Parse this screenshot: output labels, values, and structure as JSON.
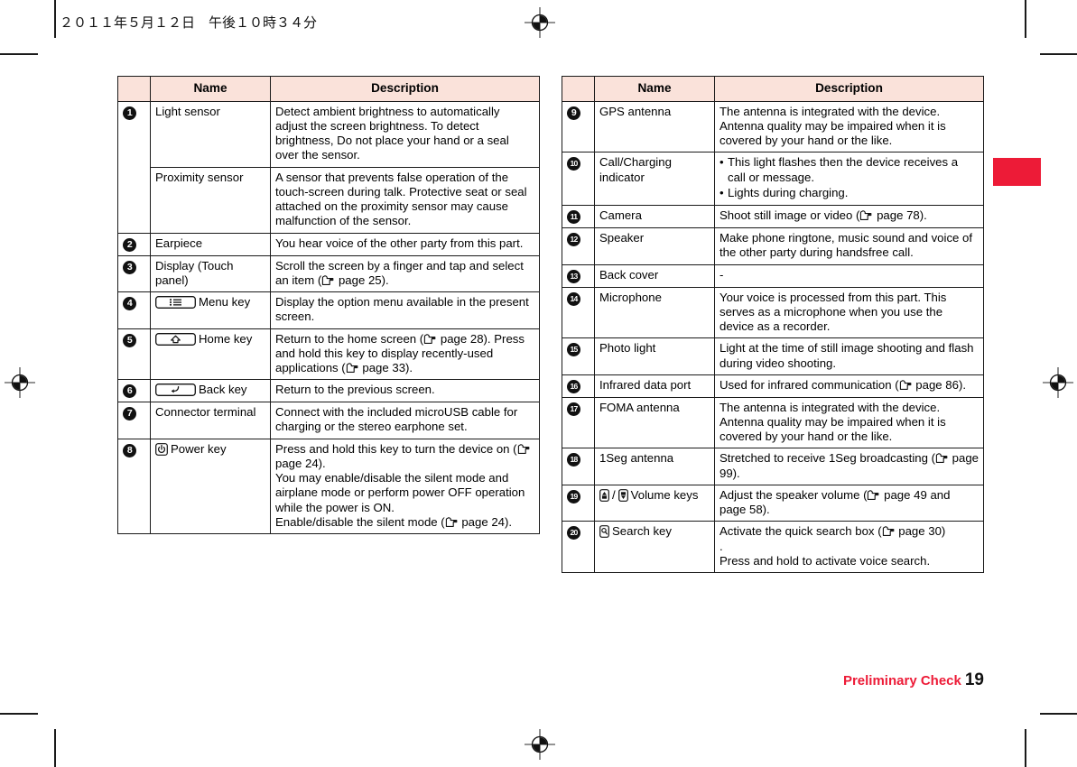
{
  "page": {
    "header_timestamp": "２０１１年５月１２日　午後１０時３４分",
    "footer_chapter": "Preliminary Check",
    "footer_page_number": "19",
    "accent_color": "#ED1B37",
    "header_row_color": "#FAE2DA"
  },
  "tables": [
    {
      "id": "left-table",
      "columns": [
        "",
        "Name",
        "Description"
      ],
      "rows": [
        {
          "num": "1",
          "num_icon": "circled-number-1",
          "name": "Light sensor",
          "desc": "Detect ambient brightness to automatically adjust the screen brightness. To detect brightness, Do not place your hand or a seal over the sensor."
        },
        {
          "num": "",
          "num_icon": "",
          "name": "Proximity sensor",
          "desc": "A sensor that prevents false operation of the touch-screen during talk. Protective seat or seal attached on the proximity sensor may cause malfunction of the sensor."
        },
        {
          "num": "2",
          "num_icon": "circled-number-2",
          "name": "Earpiece",
          "desc": "You hear voice of the other party from this part."
        },
        {
          "num": "3",
          "num_icon": "circled-number-3",
          "name": "Display (Touch panel)",
          "desc_pre": "Scroll the screen by a finger and tap and select an item (",
          "ref_icon": "pointing-hand-icon",
          "desc_post": " page 25)."
        },
        {
          "num": "4",
          "num_icon": "circled-number-4",
          "key_icon": "menu-key-icon",
          "name": "Menu key",
          "desc": "Display the option menu available in the present screen."
        },
        {
          "num": "5",
          "num_icon": "circled-number-5",
          "key_icon": "home-key-icon",
          "name": "Home key",
          "desc_pre": "Return to the home screen (",
          "ref_icon": "pointing-hand-icon",
          "desc_mid": " page 28). Press and hold this key to display recently-used applications (",
          "desc_post": " page 33)."
        },
        {
          "num": "6",
          "num_icon": "circled-number-6",
          "key_icon": "back-key-icon",
          "name": "Back key",
          "desc": "Return to the previous screen."
        },
        {
          "num": "7",
          "num_icon": "circled-number-7",
          "name": "Connector terminal",
          "desc": "Connect with the included microUSB cable for charging or the stereo earphone set."
        },
        {
          "num": "8",
          "num_icon": "circled-number-8",
          "key_icon": "power-key-icon",
          "name": "Power key",
          "desc_pre": "Press and hold this key to turn the device on (",
          "ref_icon": "pointing-hand-icon",
          "desc_mid": " page 24).\nYou may enable/disable the silent mode and airplane mode or perform power OFF operation while the power is ON.\nEnable/disable the silent mode (",
          "desc_post": " page 24)."
        }
      ]
    },
    {
      "id": "right-table",
      "columns": [
        "",
        "Name",
        "Description"
      ],
      "rows": [
        {
          "num": "9",
          "num_icon": "circled-number-9",
          "name": "GPS antenna",
          "desc": "The antenna is integrated with the device. Antenna quality may be impaired when it is covered by your hand or the like."
        },
        {
          "num": "10",
          "num_icon": "circled-number-10",
          "name": "Call/Charging indicator",
          "desc_list": [
            "This light flashes then the device receives a call or message.",
            "Lights during charging."
          ]
        },
        {
          "num": "11",
          "num_icon": "circled-number-11",
          "name": "Camera",
          "desc_pre": "Shoot still image or video (",
          "ref_icon": "pointing-hand-icon",
          "desc_post": " page 78)."
        },
        {
          "num": "12",
          "num_icon": "circled-number-12",
          "name": "Speaker",
          "desc": "Make phone ringtone, music sound and voice of the other party during handsfree call."
        },
        {
          "num": "13",
          "num_icon": "circled-number-13",
          "name": "Back cover",
          "desc": "-",
          "desc_centered": true
        },
        {
          "num": "14",
          "num_icon": "circled-number-14",
          "name": "Microphone",
          "desc": "Your voice is processed from this part. This serves as a microphone when you use the device as a recorder."
        },
        {
          "num": "15",
          "num_icon": "circled-number-15",
          "name": "Photo light",
          "desc": "Light at the time of still image shooting and flash during video shooting."
        },
        {
          "num": "16",
          "num_icon": "circled-number-16",
          "name": "Infrared data port",
          "desc_pre": "Used for infrared communication (",
          "ref_icon": "pointing-hand-icon",
          "desc_post": " page 86)."
        },
        {
          "num": "17",
          "num_icon": "circled-number-17",
          "name": "FOMA antenna",
          "desc": "The antenna is integrated with the device. Antenna quality may be impaired when it is covered by your hand or the like."
        },
        {
          "num": "18",
          "num_icon": "circled-number-18",
          "name": "1Seg antenna",
          "desc_pre": "Stretched to receive 1Seg broadcasting (",
          "ref_icon": "pointing-hand-icon",
          "desc_post": " page 99)."
        },
        {
          "num": "19",
          "num_icon": "circled-number-19",
          "key_icon": "volume-keys-icon",
          "name": "Volume keys",
          "name_separator": "/",
          "desc_pre": "Adjust the speaker volume (",
          "ref_icon": "pointing-hand-icon",
          "desc_post": " page 49 and page 58)."
        },
        {
          "num": "20",
          "num_icon": "circled-number-20",
          "key_icon": "search-key-icon",
          "name": "Search key",
          "desc_pre": "Activate the quick search box (",
          "ref_icon": "pointing-hand-icon",
          "desc_mid": " page 30)\n.\n",
          "desc_post": "Press and hold to activate voice search."
        }
      ]
    }
  ]
}
